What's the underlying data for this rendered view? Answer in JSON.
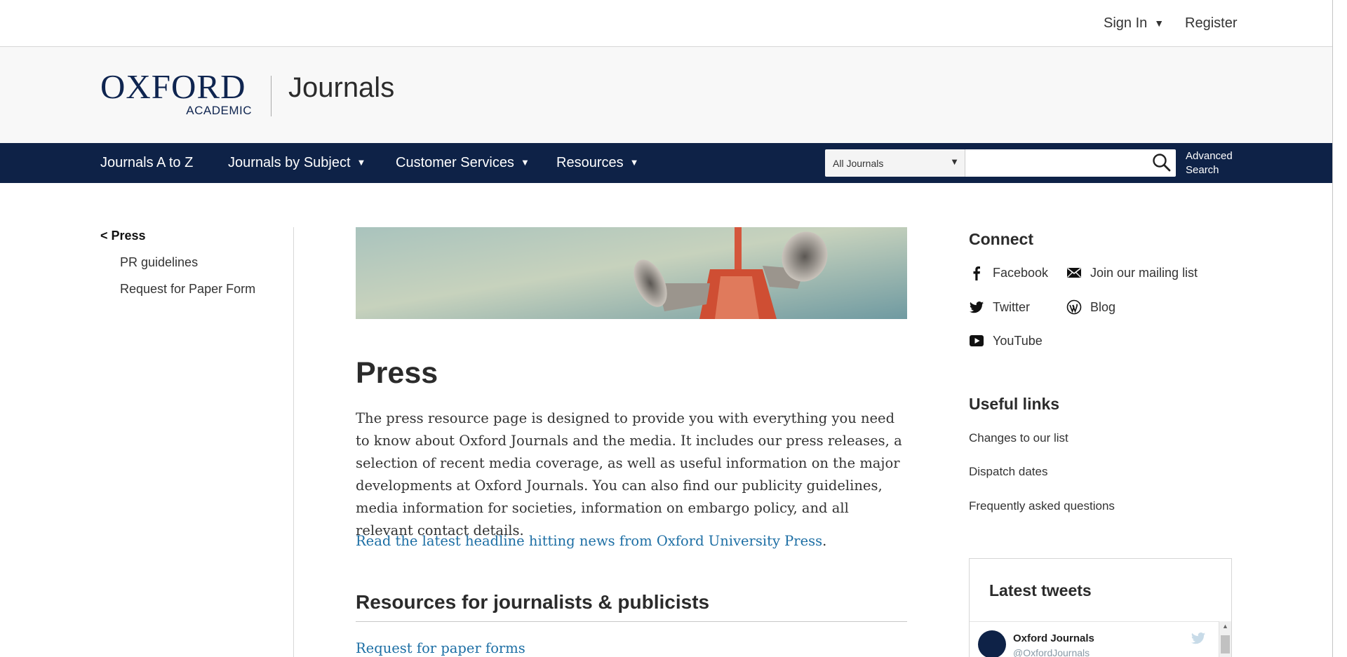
{
  "topbar": {
    "sign_in": "Sign In",
    "register": "Register"
  },
  "brand": {
    "logo_main": "OXFORD",
    "logo_sub": "ACADEMIC",
    "section": "Journals"
  },
  "nav": {
    "items": [
      {
        "label": "Journals A to Z"
      },
      {
        "label": "Journals by Subject"
      },
      {
        "label": "Customer Services"
      },
      {
        "label": "Resources"
      }
    ],
    "search_scope": "All Journals",
    "search_value": "",
    "advanced_line1": "Advanced",
    "advanced_line2": "Search"
  },
  "sidebar": {
    "parent": "< Press",
    "items": [
      {
        "label": "PR guidelines"
      },
      {
        "label": "Request for Paper Form"
      }
    ]
  },
  "main": {
    "title": "Press",
    "body": "The press resource page is designed to provide you with everything you need to know about Oxford Journals and the media. It includes our press releases, a selection of recent media coverage, as well as useful information on the major developments at Oxford Journals. You can also find our publicity guidelines, media information for societies, information on embargo policy, and all relevant contact details.",
    "news_link": "Read the latest headline hitting news from Oxford University Press",
    "news_link_suffix": ".",
    "section_title": "Resources for journalists & publicists",
    "section_link": "Request for paper forms"
  },
  "connect": {
    "title": "Connect",
    "facebook": "Facebook",
    "mailing": "Join our mailing list",
    "twitter": "Twitter",
    "blog": "Blog",
    "youtube": "YouTube"
  },
  "useful": {
    "title": "Useful links",
    "items": [
      {
        "label": "Changes to our list"
      },
      {
        "label": "Dispatch dates"
      },
      {
        "label": "Frequently asked questions"
      }
    ]
  },
  "tweets": {
    "title": "Latest tweets",
    "author": "Oxford Journals",
    "handle": "@OxfordJournals"
  },
  "colors": {
    "navy": "#0e2247",
    "link": "#1c6ea4"
  }
}
